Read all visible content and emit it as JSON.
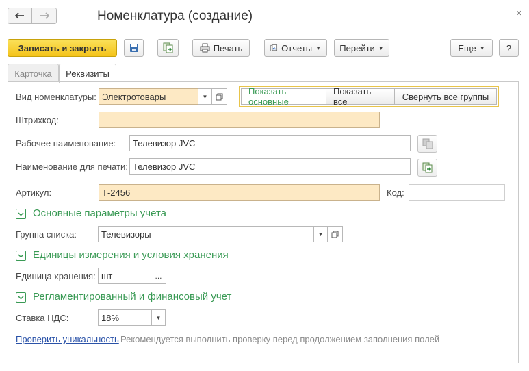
{
  "window": {
    "title": "Номенклатура (создание)",
    "close_glyph": "×",
    "back_glyph": "🡐",
    "forward_glyph": "🡒"
  },
  "toolbar": {
    "save_close_label": "Записать и закрыть",
    "print_label": "Печать",
    "reports_label": "Отчеты",
    "goto_label": "Перейти",
    "more_label": "Еще",
    "help_label": "?"
  },
  "tabs": [
    {
      "label": "Карточка",
      "active": false
    },
    {
      "label": "Реквизиты",
      "active": true
    }
  ],
  "form": {
    "kind_label": "Вид номенклатуры:",
    "kind_value": "Электротовары",
    "barcode_label": "Штрихкод:",
    "barcode_value": "",
    "work_name_label": "Рабочее наименование:",
    "work_name_value": "Телевизор JVC",
    "print_name_label": "Наименование для печати:",
    "print_name_value": "Телевизор JVC",
    "article_label": "Артикул:",
    "article_value": "Т-2456",
    "code_label": "Код:",
    "code_value": ""
  },
  "view_switch": {
    "show_main": "Показать основные",
    "show_all": "Показать все",
    "collapse_all": "Свернуть все группы"
  },
  "sections": {
    "accounting": {
      "title": "Основные параметры учета",
      "group_label": "Группа списка:",
      "group_value": "Телевизоры"
    },
    "units": {
      "title": "Единицы измерения и условия хранения",
      "unit_label": "Единица хранения:",
      "unit_value": "шт",
      "ellipsis": "..."
    },
    "finance": {
      "title": "Регламентированный и финансовый учет",
      "vat_label": "Ставка НДС:",
      "vat_value": "18%"
    }
  },
  "footer": {
    "check_link": "Проверить уникальность",
    "hint": "Рекомендуется выполнить проверку перед продолжением заполнения полей"
  },
  "colors": {
    "accent_green": "#3a9a55",
    "primary_yellow": "#f4c31a",
    "required_fill": "#fde9c4"
  }
}
